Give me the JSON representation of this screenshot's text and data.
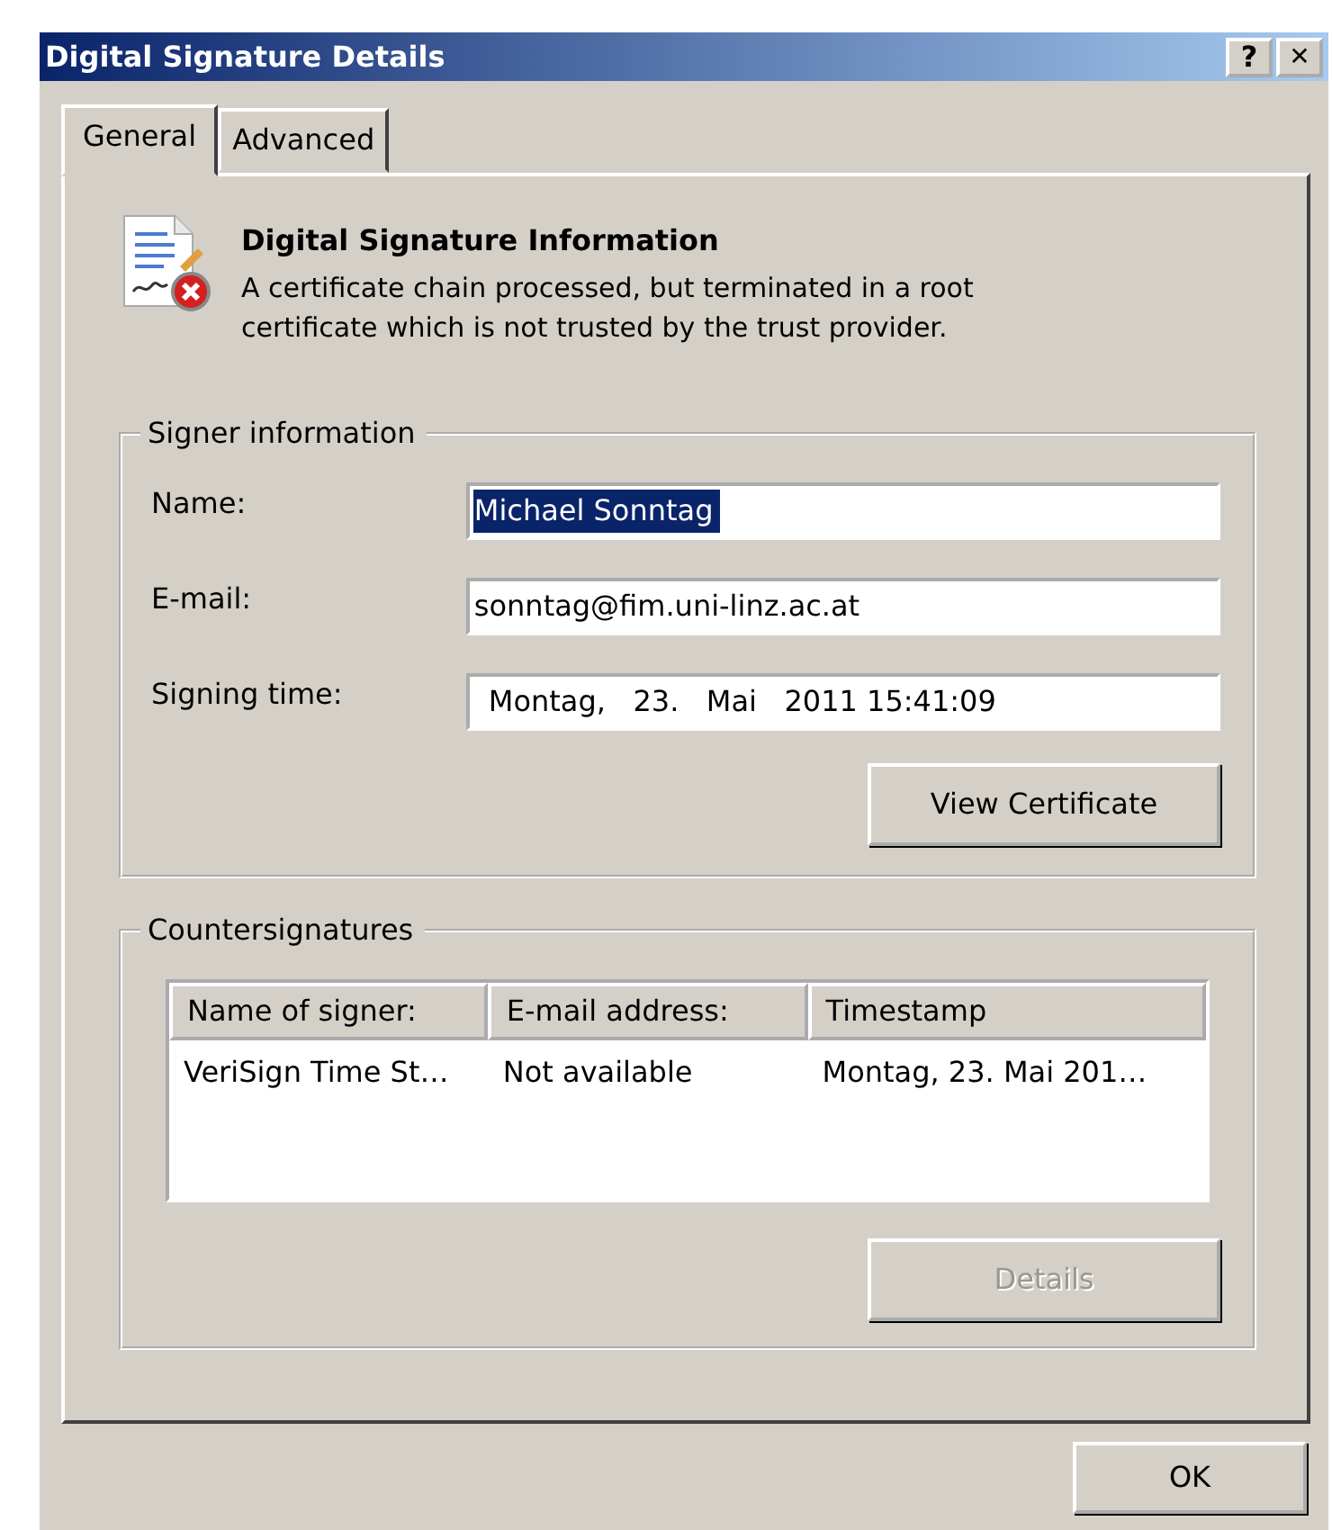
{
  "window": {
    "title": "Digital Signature Details",
    "buttons": [
      {
        "kind": "help",
        "label": "?"
      },
      {
        "kind": "close",
        "label": "✕"
      }
    ]
  },
  "tabs": [
    {
      "label": "General",
      "selected": true
    },
    {
      "label": "Advanced",
      "selected": false
    }
  ],
  "info": {
    "heading": "Digital Signature Information",
    "message": "A certificate chain processed, but terminated in a root certificate which is not trusted by the trust provider."
  },
  "signer": {
    "title": "Signer information",
    "fields": [
      {
        "label": "Name:",
        "value": "Michael Sonntag",
        "text_selected": true
      },
      {
        "label": "E-mail:",
        "value": "sonntag@fim.uni-linz.ac.at",
        "text_selected": false
      },
      {
        "label": "Signing time:",
        "value": "Montag,   23.   Mai   2011 15:41:09",
        "text_selected": false
      }
    ],
    "button": {
      "label": "View Certificate",
      "disabled": false
    }
  },
  "countersignatures": {
    "title": "Countersignatures",
    "columns": [
      "Name of signer:",
      "E-mail address:",
      "Timestamp"
    ],
    "rows": [
      [
        "VeriSign Time St…",
        "Not available",
        "Montag, 23. Mai 201…"
      ]
    ],
    "button": {
      "label": "Details",
      "disabled": true
    }
  },
  "footer": {
    "button": "OK"
  }
}
